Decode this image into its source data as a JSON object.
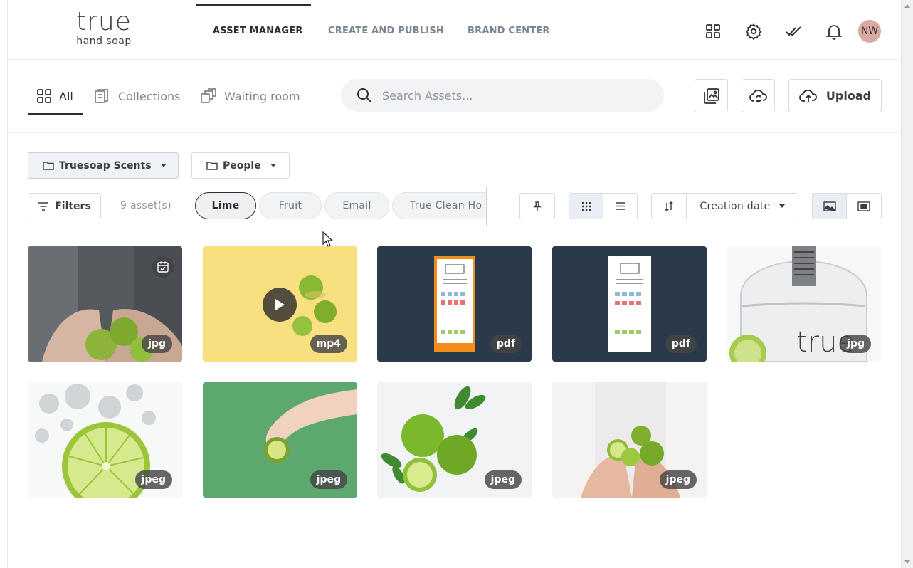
{
  "logo": {
    "word": "true",
    "sub": "hand soap"
  },
  "topnav": [
    {
      "label": "ASSET MANAGER",
      "active": true
    },
    {
      "label": "CREATE AND PUBLISH",
      "active": false
    },
    {
      "label": "BRAND CENTER",
      "active": false
    }
  ],
  "header_icons": [
    "apps-grid-icon",
    "gear-icon",
    "double-check-icon",
    "bell-icon"
  ],
  "user": {
    "initials": "NW",
    "color": "#d9a9a6"
  },
  "subtabs": [
    {
      "label": "All",
      "icon": "grid-icon",
      "active": true
    },
    {
      "label": "Collections",
      "icon": "collections-icon",
      "active": false
    },
    {
      "label": "Waiting room",
      "icon": "waiting-room-icon",
      "active": false
    }
  ],
  "search": {
    "placeholder": "Search Assets..."
  },
  "upload": {
    "label": "Upload"
  },
  "folders": [
    {
      "label": "Truesoap Scents",
      "selected": true
    },
    {
      "label": "People",
      "selected": false
    }
  ],
  "filters": {
    "label": "Filters",
    "count": "9 asset(s)"
  },
  "chips": [
    {
      "label": "Lime",
      "active": true
    },
    {
      "label": "Fruit",
      "active": false
    },
    {
      "label": "Email",
      "active": false
    },
    {
      "label": "True Clean Ho",
      "active": false
    }
  ],
  "sort": {
    "label": "Creation date"
  },
  "assets": [
    {
      "type": "jpg",
      "subject": "hands-holding-limes-dark",
      "scheduled": true
    },
    {
      "type": "mp4",
      "subject": "limes-on-yellow-video"
    },
    {
      "type": "pdf",
      "subject": "true-flyer-orange"
    },
    {
      "type": "pdf",
      "subject": "true-flyer-white"
    },
    {
      "type": "jpg",
      "subject": "true-bottle-with-lime"
    },
    {
      "type": "jpeg",
      "subject": "lime-slice-in-water"
    },
    {
      "type": "jpeg",
      "subject": "hand-holding-lime-green"
    },
    {
      "type": "jpeg",
      "subject": "limes-with-leaves"
    },
    {
      "type": "jpeg",
      "subject": "hands-holding-lime-halves"
    }
  ],
  "colors": {
    "accent": "#2b2f33",
    "muted": "#7b8590",
    "panel": "#2b3a4a",
    "avatar": "#d9a9a6"
  }
}
